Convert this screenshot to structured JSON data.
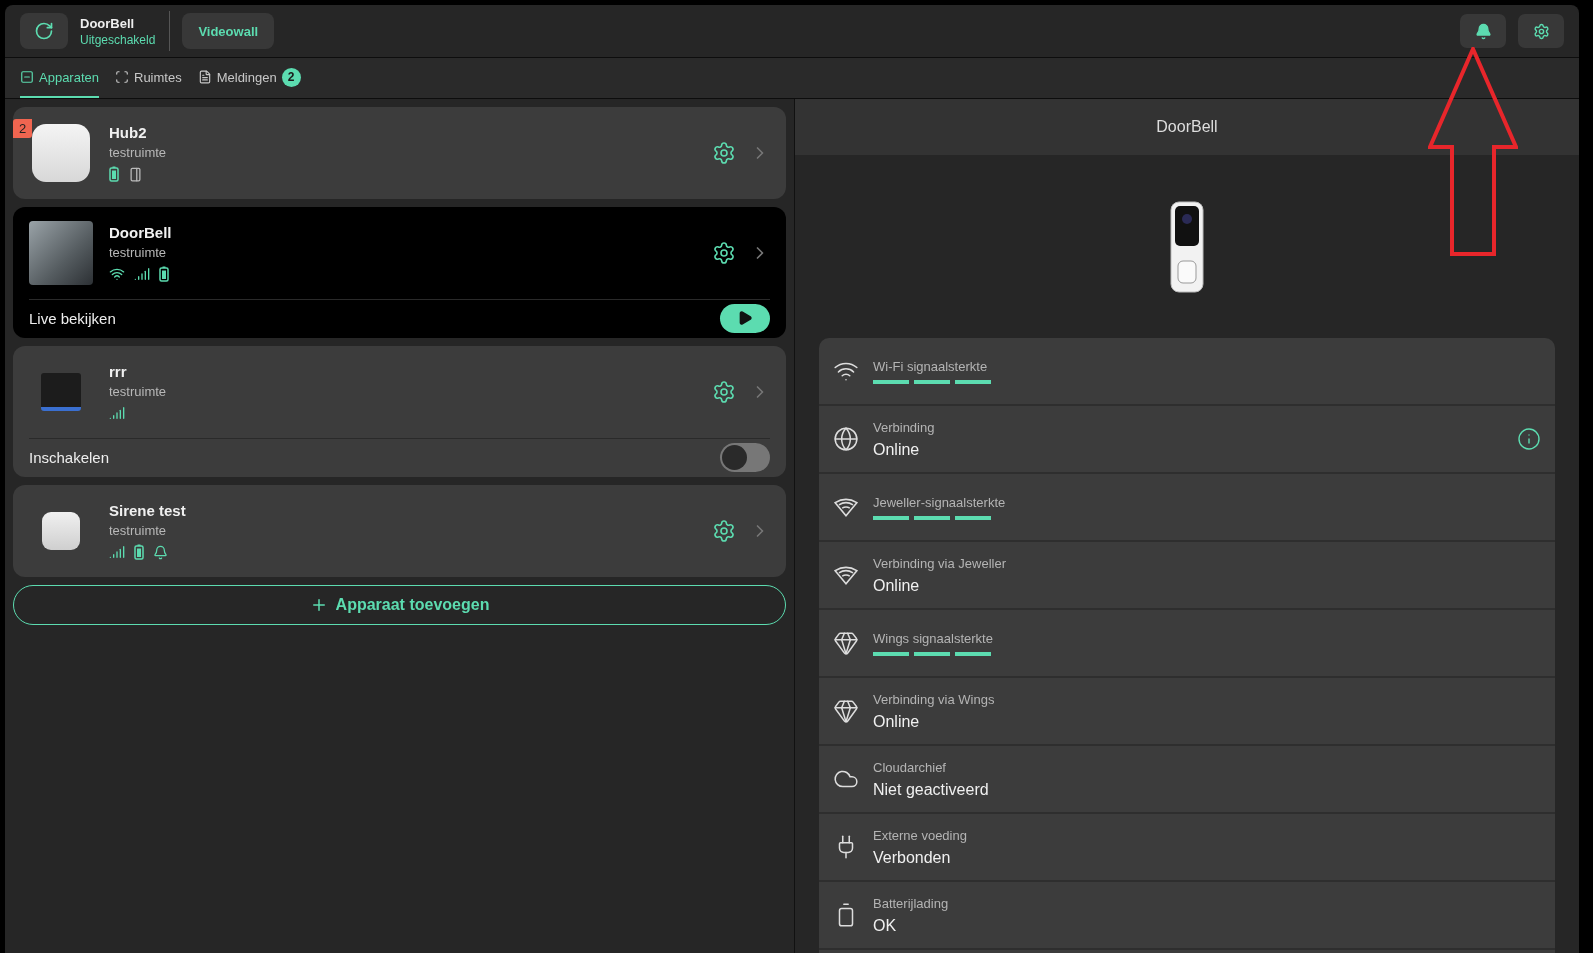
{
  "header": {
    "title": "DoorBell",
    "status": "Uitgeschakeld",
    "videowall_button": "Videowall"
  },
  "tabs": [
    {
      "label": "Apparaten",
      "selected": true
    },
    {
      "label": "Ruimtes",
      "selected": false
    },
    {
      "label": "Meldingen",
      "selected": false,
      "badge": "2"
    }
  ],
  "devices": [
    {
      "name": "Hub2",
      "room": "testruimte",
      "badge": "2"
    },
    {
      "name": "DoorBell",
      "room": "testruimte",
      "extra": {
        "kind": "live",
        "label": "Live bekijken"
      }
    },
    {
      "name": "rrr",
      "room": "testruimte",
      "extra": {
        "kind": "toggle",
        "label": "Inschakelen",
        "on": false
      }
    },
    {
      "name": "Sirene test",
      "room": "testruimte"
    }
  ],
  "add_button": "Apparaat toevoegen",
  "detail": {
    "title": "DoorBell",
    "rows": [
      {
        "kind": "meter",
        "label": "Wi-Fi signaalsterkte"
      },
      {
        "kind": "value",
        "label": "Verbinding",
        "value": "Online",
        "info": true
      },
      {
        "kind": "meter",
        "label": "Jeweller-signaalsterkte"
      },
      {
        "kind": "value",
        "label": "Verbinding via Jeweller",
        "value": "Online"
      },
      {
        "kind": "meter",
        "label": "Wings signaalsterkte"
      },
      {
        "kind": "value",
        "label": "Verbinding via Wings",
        "value": "Online"
      },
      {
        "kind": "value",
        "label": "Cloudarchief",
        "value": "Niet geactiveerd"
      },
      {
        "kind": "value",
        "label": "Externe voeding",
        "value": "Verbonden"
      },
      {
        "kind": "value",
        "label": "Batterijlading",
        "value": "OK"
      }
    ]
  },
  "annotation_arrow": true
}
